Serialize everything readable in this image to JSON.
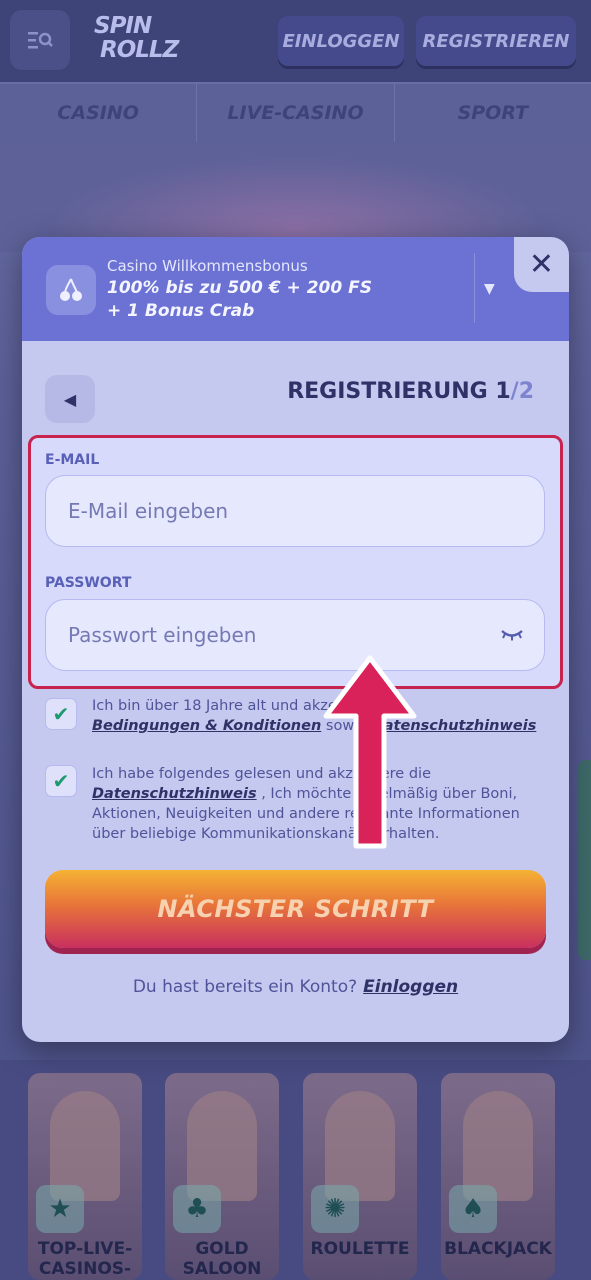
{
  "header": {
    "logo_line1": "SPIN",
    "logo_line2": "ROLLZ",
    "login_label": "EINLOGGEN",
    "register_label": "REGISTRIEREN"
  },
  "nav": {
    "items": [
      "CASINO",
      "LIVE-CASINO",
      "SPORT"
    ]
  },
  "bonus": {
    "title": "Casino Willkommensbonus",
    "text": "100% bis zu 500 € + 200 FS + 1 Bonus Crab"
  },
  "form": {
    "title_prefix": "REGISTRIERUNG 1",
    "title_total": "/2",
    "email_label": "E-MAIL",
    "email_placeholder": "E-Mail eingeben",
    "password_label": "PASSWORT",
    "password_placeholder": "Passwort eingeben"
  },
  "terms": {
    "line1": "Ich bin über 18 Jahre alt und akzeptiere",
    "link1": "Bedingungen & Konditionen",
    "mid": " sowie ",
    "link2": "Datenschutzhinweis"
  },
  "marketing": {
    "line1": "Ich habe folgendes gelesen und akzeptiere die",
    "link": "Datenschutzhinweis",
    "rest": " , Ich möchte regelmäßig über Boni, Aktionen, Neuigkeiten und andere relevante Informationen über beliebige Kommunikationskanäle erhalten."
  },
  "next_button": "NÄCHSTER SCHRITT",
  "have_account": {
    "text": "Du hast bereits ein Konto?",
    "link": "Einloggen"
  },
  "games": [
    {
      "name": "TOP-LIVE-CASINOS-",
      "icon": "star-icon"
    },
    {
      "name": "GOLD SALOON",
      "icon": "club-icon"
    },
    {
      "name": "ROULETTE",
      "icon": "roulette-icon"
    },
    {
      "name": "BLACKJACK",
      "icon": "spade-icon"
    }
  ],
  "colors": {
    "accent_red": "#c8224e",
    "check_green": "#1d9a6e",
    "bonus_bar": "#6b72d4"
  }
}
